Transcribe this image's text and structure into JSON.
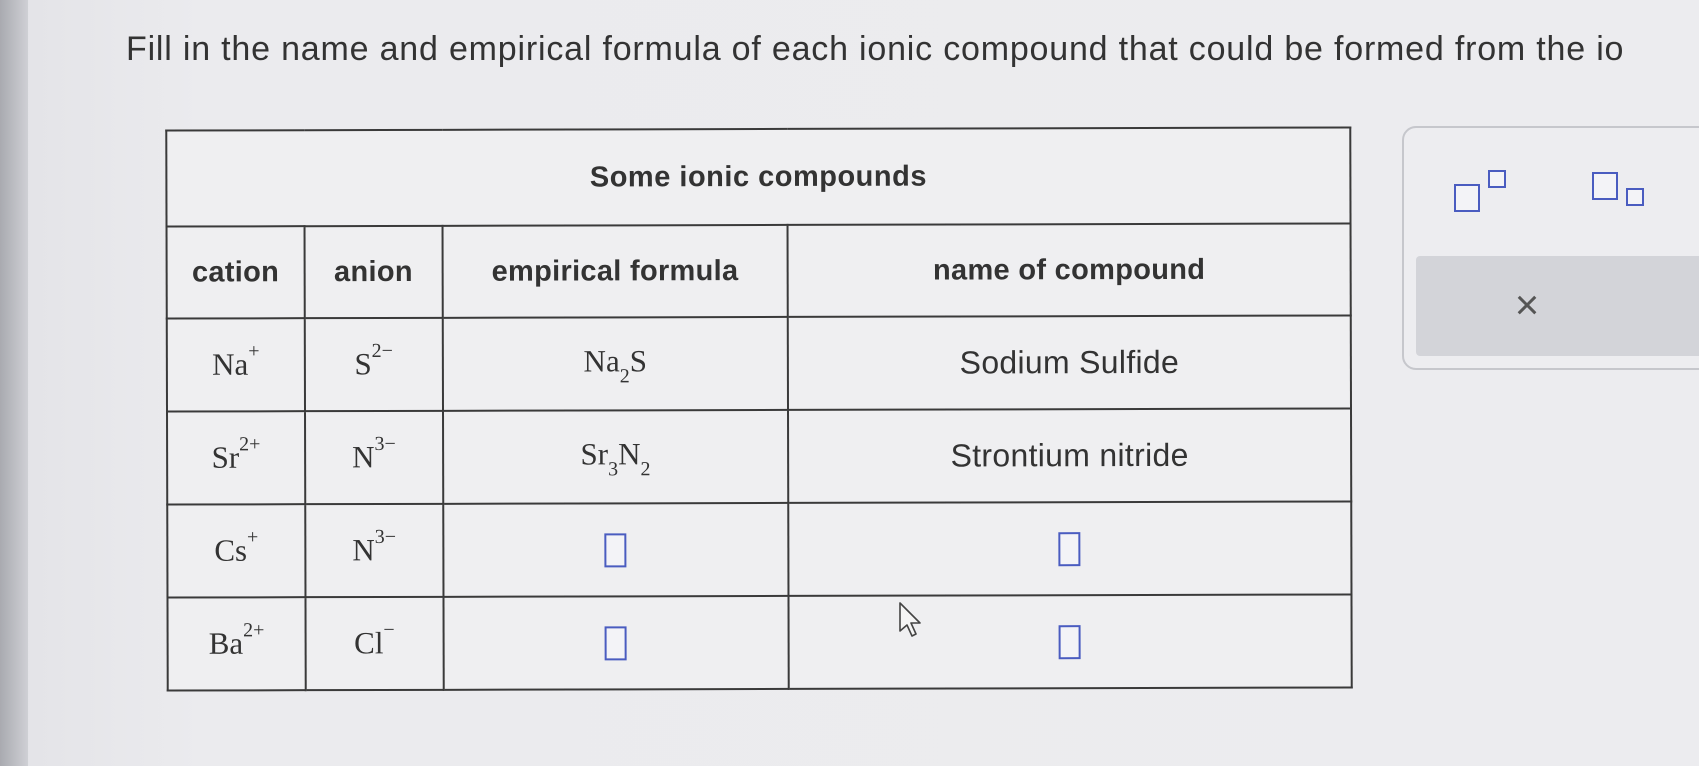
{
  "prompt": "Fill in the name and empirical formula of each ionic compound that could be formed from the io",
  "table": {
    "title": "Some ionic compounds",
    "headers": {
      "cation": "cation",
      "anion": "anion",
      "formula": "empirical formula",
      "name": "name of compound"
    },
    "rows": [
      {
        "cation": {
          "symbol": "Na",
          "charge": "+"
        },
        "anion": {
          "symbol": "S",
          "charge": "2−"
        },
        "formula": {
          "p1": "Na",
          "s1": "2",
          "p2": "S",
          "s2": ""
        },
        "name": "Sodium Sulfide"
      },
      {
        "cation": {
          "symbol": "Sr",
          "charge": "2+"
        },
        "anion": {
          "symbol": "N",
          "charge": "3−"
        },
        "formula": {
          "p1": "Sr",
          "s1": "3",
          "p2": "N",
          "s2": "2"
        },
        "name": "Strontium nitride"
      },
      {
        "cation": {
          "symbol": "Cs",
          "charge": "+"
        },
        "anion": {
          "symbol": "N",
          "charge": "3−"
        },
        "formula": null,
        "name": null
      },
      {
        "cation": {
          "symbol": "Ba",
          "charge": "2+"
        },
        "anion": {
          "symbol": "Cl",
          "charge": "−"
        },
        "formula": null,
        "name": null
      }
    ]
  },
  "toolbar": {
    "superscript_icon": "superscript-icon",
    "subscript_icon": "subscript-icon",
    "close_glyph": "×"
  },
  "colors": {
    "accent": "#4a5cc0",
    "border": "#3a3a3a"
  }
}
